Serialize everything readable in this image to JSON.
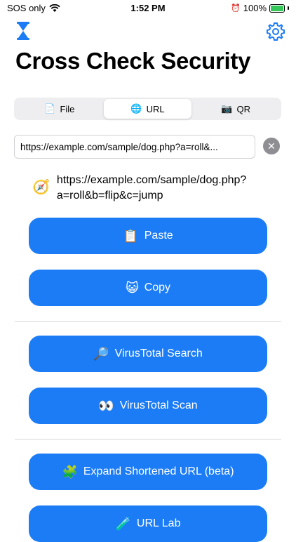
{
  "status": {
    "carrier": "SOS only",
    "time": "1:52 PM",
    "battery": "100%"
  },
  "header": {
    "title": "Cross Check Security",
    "left_icon": "hourglass-icon",
    "right_icon": "gear-icon",
    "accent": "#1b7cf6"
  },
  "tabs": [
    {
      "label": "File",
      "icon": "📄"
    },
    {
      "label": "URL",
      "icon": "🌐"
    },
    {
      "label": "QR",
      "icon": "📷"
    }
  ],
  "url_input": {
    "value": "https://example.com/sample/dog.php?a=roll&..."
  },
  "link": {
    "icon": "🧭",
    "line1": "https://example.com/sample/dog.php?",
    "line2": "a=roll&b=flip&c=jump"
  },
  "buttons": {
    "paste": {
      "label": "Paste",
      "icon": "📋"
    },
    "copy": {
      "label": "Copy",
      "icon": "😺"
    },
    "vt_search": {
      "label": "VirusTotal Search",
      "icon": "🔎"
    },
    "vt_scan": {
      "label": "VirusTotal Scan",
      "icon": "👀"
    },
    "expand": {
      "label": "Expand Shortened URL (beta)",
      "icon": "🧩"
    },
    "lab": {
      "label": "URL Lab",
      "icon": "🧪"
    }
  }
}
